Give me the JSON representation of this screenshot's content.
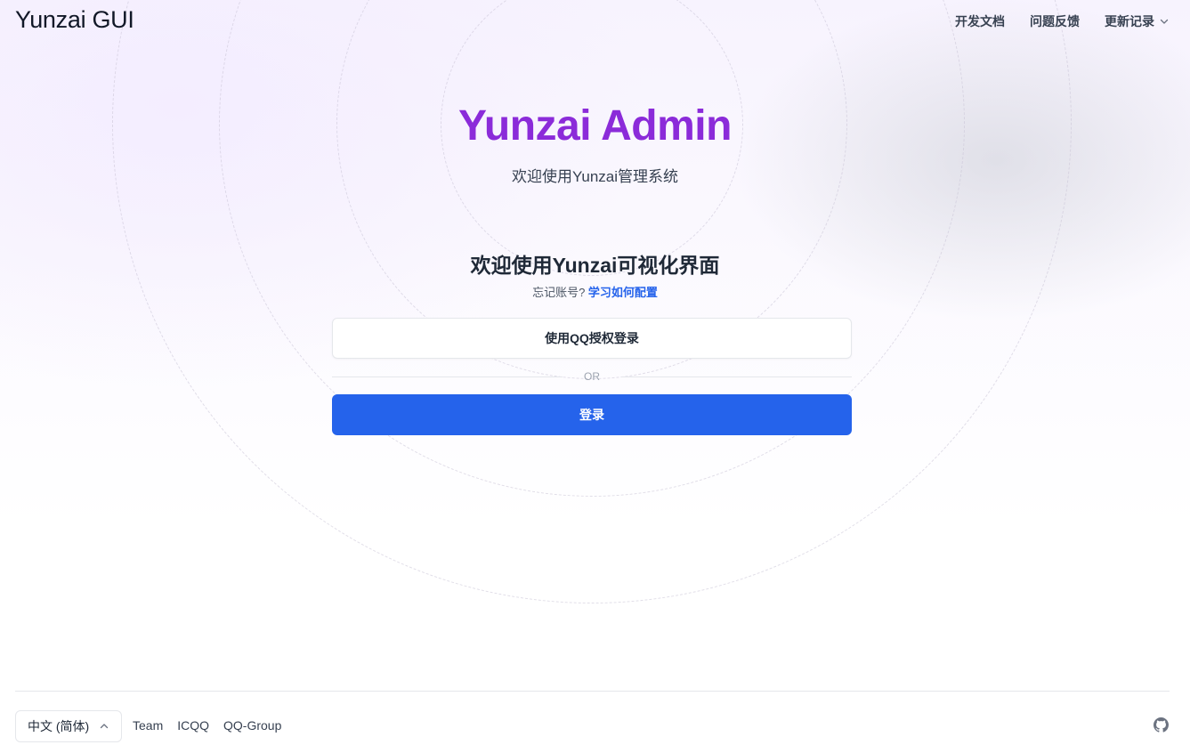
{
  "header": {
    "brand": "Yunzai GUI",
    "nav": {
      "docs": "开发文档",
      "feedback": "问题反馈",
      "changelog": "更新记录"
    }
  },
  "hero": {
    "title": "Yunzai Admin",
    "subtitle": "欢迎使用Yunzai管理系统"
  },
  "form": {
    "title": "欢迎使用Yunzai可视化界面",
    "help_prefix": "忘记账号?",
    "help_link": "学习如何配置",
    "qq_button": "使用QQ授权登录",
    "or_label": "OR",
    "login_button": "登录"
  },
  "footer": {
    "language": "中文 (简体)",
    "links": [
      "Team",
      "ICQQ",
      "QQ-Group"
    ]
  },
  "colors": {
    "brand_purple": "#8b2bd9",
    "primary_blue": "#2563eb"
  },
  "icons": [
    "chevron-down-icon",
    "chevron-up-icon",
    "github-icon"
  ]
}
